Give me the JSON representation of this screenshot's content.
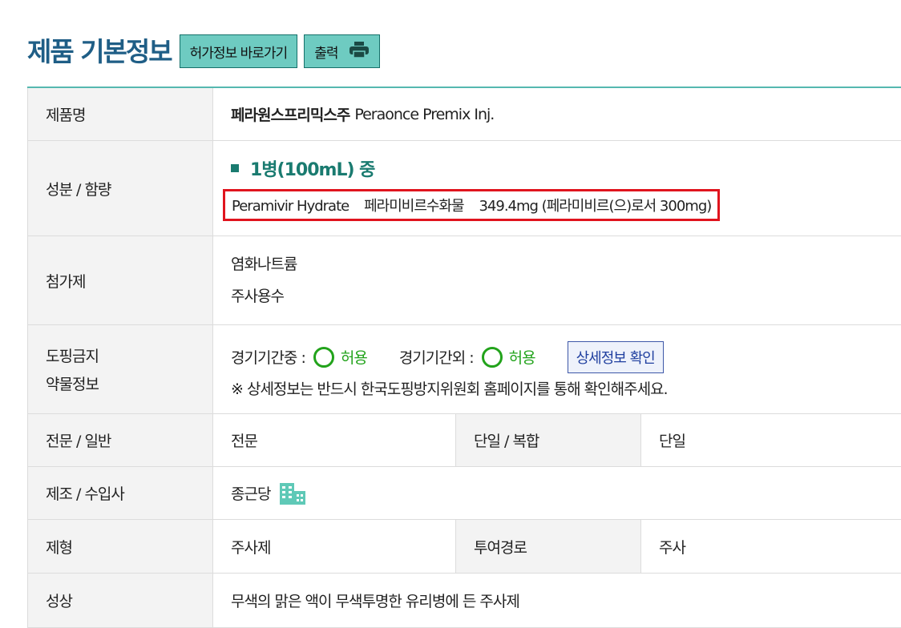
{
  "header": {
    "title": "제품 기본정보",
    "permit_link": "허가정보 바로가기",
    "print_label": "출력",
    "print_icon": "printer-icon"
  },
  "rows": {
    "product_name": {
      "label": "제품명",
      "name_ko": "페라원스프리믹스주",
      "name_en": "Peraonce Premix Inj."
    },
    "ingredient": {
      "label": "성분 / 함량",
      "unit": "1병(100mL) 중",
      "detail": "Peramivir Hydrate    페라미비르수화물    349.4mg (페라미비르(으)로서 300mg)"
    },
    "additive": {
      "label": "첨가제",
      "items": [
        "염화나트륨",
        "주사용수"
      ]
    },
    "doping": {
      "label_line1": "도핑금지",
      "label_line2": "약물정보",
      "in_comp_label": "경기기간중 :",
      "in_comp_value": "허용",
      "out_comp_label": "경기기간외 :",
      "out_comp_value": "허용",
      "detail_button": "상세정보 확인",
      "note": "※ 상세정보는 반드시 한국도핑방지위원회 홈페이지를 통해 확인해주세요."
    },
    "category": {
      "label": "전문 / 일반",
      "value": "전문",
      "label2": "단일 / 복합",
      "value2": "단일"
    },
    "manufacturer": {
      "label": "제조 / 수입사",
      "value": "종근당",
      "icon": "building-icon"
    },
    "form": {
      "label": "제형",
      "value": "주사제",
      "label2": "투여경로",
      "value2": "주사"
    },
    "appearance": {
      "label": "성상",
      "value": "무색의 맑은 액이 무색투명한 유리병에 든 주사제"
    }
  },
  "colors": {
    "title": "#1f5e86",
    "accent_teal": "#6ecbc1",
    "allowed_green": "#22a31b",
    "highlight_red": "#e0141e"
  }
}
